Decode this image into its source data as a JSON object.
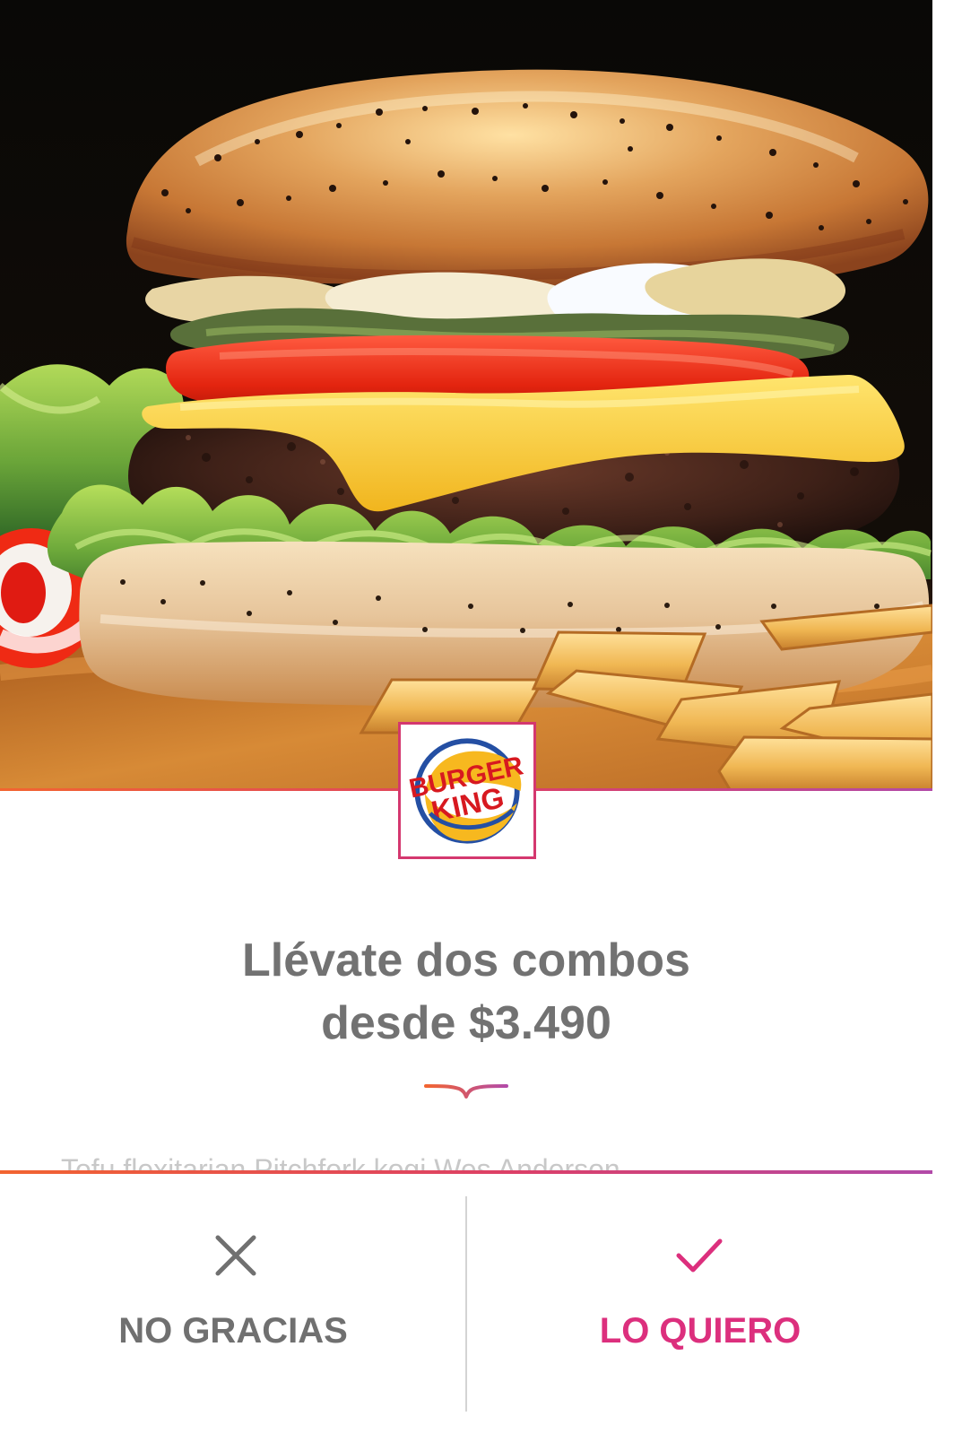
{
  "offer": {
    "title_line_1": "Llévate dos combos",
    "title_line_2": "desde $3.490",
    "description": "Tofu flexitarian Pitchfork kogi Wes Anderson"
  },
  "brand": {
    "name_top": "BURGER",
    "name_bottom": "KING"
  },
  "actions": {
    "decline_label": "NO GRACIAS",
    "accept_label": "LO QUIERO"
  },
  "icons": {
    "decline": "close-icon",
    "accept": "checkmark-icon",
    "ornament": "wave-divider-icon"
  },
  "colors": {
    "title": "#727272",
    "decline": "#707070",
    "accept": "#dc2f7d",
    "gradient_start": "#f26430",
    "gradient_end": "#b24aa8",
    "logo_red": "#d71920",
    "logo_yellow": "#f7b81f",
    "logo_blue": "#244fa3"
  }
}
